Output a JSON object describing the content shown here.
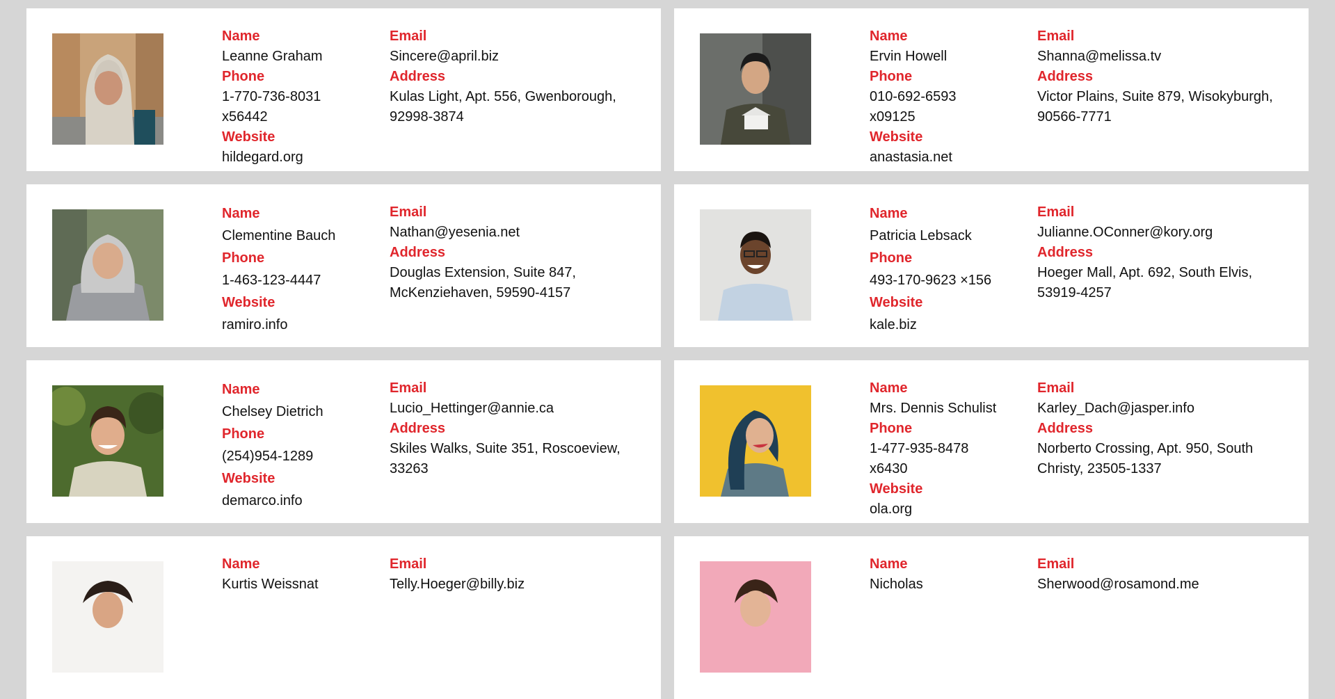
{
  "labels": {
    "name": "Name",
    "phone": "Phone",
    "website": "Website",
    "email": "Email",
    "address": "Address"
  },
  "colors": {
    "label": "#e0262c",
    "background": "#d6d6d6",
    "card": "#ffffff"
  },
  "users": [
    {
      "name": "Leanne Graham",
      "phone_line1": "1-770-736-8031",
      "phone_line2": "x56442",
      "website": "hildegard.org",
      "email": "Sincere@april.biz",
      "address_line1": "Kulas Light, Apt. 556, Gwenborough,",
      "address_line2": "92998-3874",
      "photo": "woman-hijab-portrait"
    },
    {
      "name": "Ervin Howell",
      "phone_line1": "010-692-6593",
      "phone_line2": "x09125",
      "website": "anastasia.net",
      "email": "Shanna@melissa.tv",
      "address_line1": "Victor Plains, Suite 879, Wisokyburgh,",
      "address_line2": "90566-7771",
      "photo": "man-holding-model-portrait"
    },
    {
      "name": "Clementine Bauch",
      "phone_line1": "1-463-123-4447",
      "phone_line2": "",
      "website": "ramiro.info",
      "email": "Nathan@yesenia.net",
      "address_line1": "Douglas Extension, Suite 847,",
      "address_line2": "McKenziehaven, 59590-4157",
      "photo": "gray-haired-woman-portrait"
    },
    {
      "name": "Patricia Lebsack",
      "phone_line1": "493-170-9623 ×156",
      "phone_line2": "",
      "website": "kale.biz",
      "email": "Julianne.OConner@kory.org",
      "address_line1": "Hoeger Mall, Apt. 692, South Elvis,",
      "address_line2": "53919-4257",
      "photo": "smiling-man-glasses-portrait"
    },
    {
      "name": "Chelsey Dietrich",
      "phone_line1": "(254)954-1289",
      "phone_line2": "",
      "website": "demarco.info",
      "email": "Lucio_Hettinger@annie.ca",
      "address_line1": "Skiles Walks, Suite 351, Roscoeview,",
      "address_line2": "33263",
      "photo": "young-man-smiling-portrait"
    },
    {
      "name": "Mrs. Dennis Schulist",
      "phone_line1": "1-477-935-8478",
      "phone_line2": "x6430",
      "website": "ola.org",
      "email": "Karley_Dach@jasper.info",
      "address_line1": "Norberto Crossing, Apt. 950, South",
      "address_line2": "Christy, 23505-1337",
      "photo": "woman-yellow-wall-portrait"
    },
    {
      "name": "Kurtis Weissnat",
      "phone_line1": "",
      "phone_line2": "",
      "website": "",
      "email": "Telly.Hoeger@billy.biz",
      "address_line1": "",
      "address_line2": "",
      "photo": "person-light-background-portrait"
    },
    {
      "name": "Nicholas",
      "phone_line1": "",
      "phone_line2": "",
      "website": "",
      "email": "Sherwood@rosamond.me",
      "address_line1": "",
      "address_line2": "",
      "photo": "person-pink-background-portrait"
    }
  ]
}
